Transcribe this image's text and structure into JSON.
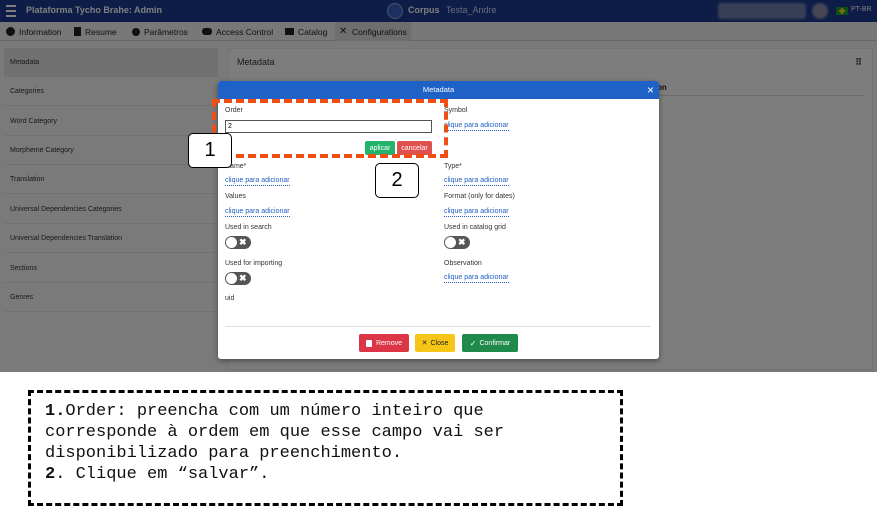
{
  "header": {
    "app_title": "Plataforma Tycho Brahe: Admin",
    "corpus_label": "Corpus",
    "corpus_name": "Testa_Andre",
    "lang": "PT-BR"
  },
  "tabs": [
    {
      "label": "Information",
      "icon": "info-icon"
    },
    {
      "label": "Resume",
      "icon": "document-icon"
    },
    {
      "label": "Parâmetros",
      "icon": "cogs-icon"
    },
    {
      "label": "Access Control",
      "icon": "users-icon"
    },
    {
      "label": "Catalog",
      "icon": "book-icon"
    },
    {
      "label": "Configurations",
      "icon": "tools-icon",
      "active": true
    }
  ],
  "sidebar": {
    "items": [
      {
        "label": "Metadata",
        "active": true
      },
      {
        "label": "Categories"
      },
      {
        "label": "Word Category"
      },
      {
        "label": "Morpheme Category"
      },
      {
        "label": "Translation"
      },
      {
        "label": "Universal Dependencies Categories"
      },
      {
        "label": "Universal Dependencies Translation"
      },
      {
        "label": "Sections"
      },
      {
        "label": "Genres"
      }
    ]
  },
  "panel": {
    "title": "Metadata",
    "menu": "⠿",
    "column_partial": "on"
  },
  "modal": {
    "title": "Metadata",
    "close": "×",
    "order_label": "Order",
    "order_value": "2",
    "apply": "aplicar",
    "cancel": "cancelar",
    "symbol_label": "Symbol",
    "symbol_link": "clique para adicionar",
    "name_label": "Name*",
    "name_link": "clique para adicionar",
    "type_label": "Type*",
    "type_link": "clique para adicionar",
    "values_label": "Values",
    "values_link": "clique para adicionar",
    "format_label": "Format (only for dates)",
    "format_link": "clique para adicionar",
    "used_search_label": "Used in search",
    "used_grid_label": "Used in catalog grid",
    "used_import_label": "Used for importing",
    "observation_label": "Observation",
    "observation_link": "clique para adicionar",
    "uid_label": "uid",
    "toggle_glyph": "✖",
    "remove": "Remove",
    "close_btn": "Close",
    "confirm": "Confirmar"
  },
  "callouts": {
    "one": "1",
    "two": "2"
  },
  "note": {
    "line1_num": "1.",
    "line1": "Order: preencha com um número inteiro que",
    "line2": "corresponde à ordem em que esse campo vai ser",
    "line3": "disponibilizado para preenchimento.",
    "line4_num": "2",
    "line4": ". Clique em “salvar”."
  },
  "colors": {
    "header": "#1d3a8f",
    "modal_header": "#1e62c7",
    "apply": "#25b36b",
    "cancel": "#e0504f",
    "remove": "#dc3545",
    "close": "#f5c518",
    "confirm": "#1f8a4c",
    "annotation": "#f04e13"
  }
}
